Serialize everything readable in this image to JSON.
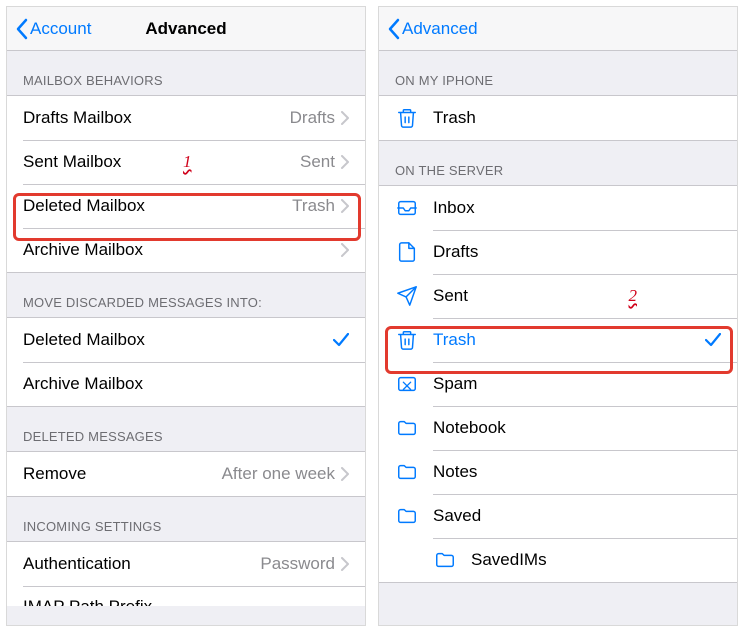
{
  "colors": {
    "accent": "#007aff",
    "annotation": "#d0021b",
    "callout": "#e23a2e"
  },
  "left": {
    "nav": {
      "back": "Account",
      "title": "Advanced"
    },
    "sections": {
      "behaviors": {
        "header": "MAILBOX BEHAVIORS",
        "items": [
          {
            "label": "Drafts Mailbox",
            "value": "Drafts",
            "disclosure": true
          },
          {
            "label": "Sent Mailbox",
            "value": "Sent",
            "disclosure": true,
            "annotation": "1"
          },
          {
            "label": "Deleted Mailbox",
            "value": "Trash",
            "disclosure": true,
            "highlighted": true
          },
          {
            "label": "Archive Mailbox",
            "value": "",
            "disclosure": true
          }
        ]
      },
      "move_discarded": {
        "header": "MOVE DISCARDED MESSAGES INTO:",
        "items": [
          {
            "label": "Deleted Mailbox",
            "checked": true
          },
          {
            "label": "Archive Mailbox",
            "checked": false
          }
        ]
      },
      "deleted_messages": {
        "header": "DELETED MESSAGES",
        "items": [
          {
            "label": "Remove",
            "value": "After one week",
            "disclosure": true
          }
        ]
      },
      "incoming": {
        "header": "INCOMING SETTINGS",
        "items": [
          {
            "label": "Authentication",
            "value": "Password",
            "disclosure": true
          },
          {
            "label_truncated": "IMAP Path Prefix"
          }
        ]
      }
    }
  },
  "right": {
    "nav": {
      "back": "Advanced",
      "title": ""
    },
    "sections": {
      "on_my_iphone": {
        "header": "ON MY IPHONE",
        "items": [
          {
            "icon": "trash-icon",
            "label": "Trash"
          }
        ]
      },
      "on_the_server": {
        "header": "ON THE SERVER",
        "items": [
          {
            "icon": "inbox-icon",
            "label": "Inbox"
          },
          {
            "icon": "file-icon",
            "label": "Drafts"
          },
          {
            "icon": "send-icon",
            "label": "Sent",
            "annotation": "2"
          },
          {
            "icon": "trash-icon",
            "label": "Trash",
            "selected": true,
            "checked": true,
            "highlighted": true
          },
          {
            "icon": "spam-icon",
            "label": "Spam"
          },
          {
            "icon": "folder-icon",
            "label": "Notebook"
          },
          {
            "icon": "folder-icon",
            "label": "Notes"
          },
          {
            "icon": "folder-icon",
            "label": "Saved"
          },
          {
            "icon": "folder-icon",
            "label": "SavedIMs",
            "indent": true
          }
        ]
      }
    }
  }
}
